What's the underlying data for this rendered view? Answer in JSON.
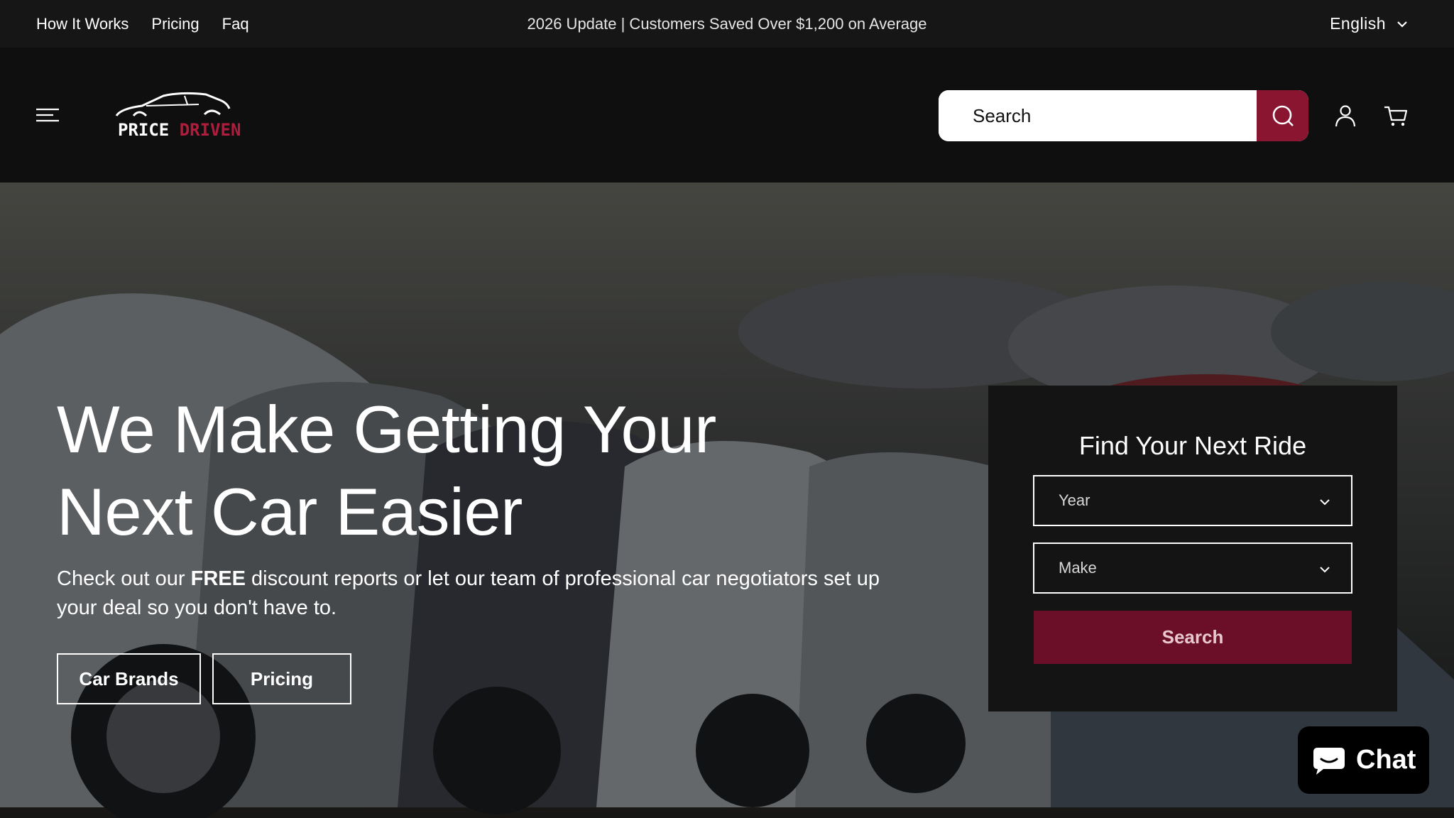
{
  "topbar": {
    "nav": [
      {
        "label": "How It Works"
      },
      {
        "label": "Pricing"
      },
      {
        "label": "Faq"
      }
    ],
    "announcement": "2026 Update | Customers Saved Over $1,200 on Average",
    "language": "English",
    "language_icon": "chevron-down-icon"
  },
  "header": {
    "menu_icon": "hamburger-menu-icon",
    "logo": {
      "word1": "PRICE",
      "word2": "DRIVEN"
    },
    "search": {
      "placeholder": "Search",
      "icon": "search-icon"
    },
    "account_icon": "user-icon",
    "cart_icon": "cart-icon"
  },
  "hero": {
    "headline_line1": "We Make Getting Your",
    "headline_line2": "Next Car Easier",
    "sub_pre": "Check out our ",
    "sub_bold": "FREE",
    "sub_post": " discount reports or let our team of professional car negotiators set up your deal so you don't have to.",
    "buttons": [
      {
        "label": "Car Brands"
      },
      {
        "label": "Pricing"
      }
    ]
  },
  "finder": {
    "title": "Find Your Next Ride",
    "year_placeholder": "Year",
    "make_placeholder": "Make",
    "search_label": "Search"
  },
  "chat": {
    "label": "Chat",
    "icon": "chat-bubble-icon"
  },
  "colors": {
    "accent": "#8a1530",
    "panel_button": "#6b0e27",
    "logo_red": "#b01c3c",
    "topbar_bg": "#161616",
    "header_bg": "#0f0f0f"
  }
}
